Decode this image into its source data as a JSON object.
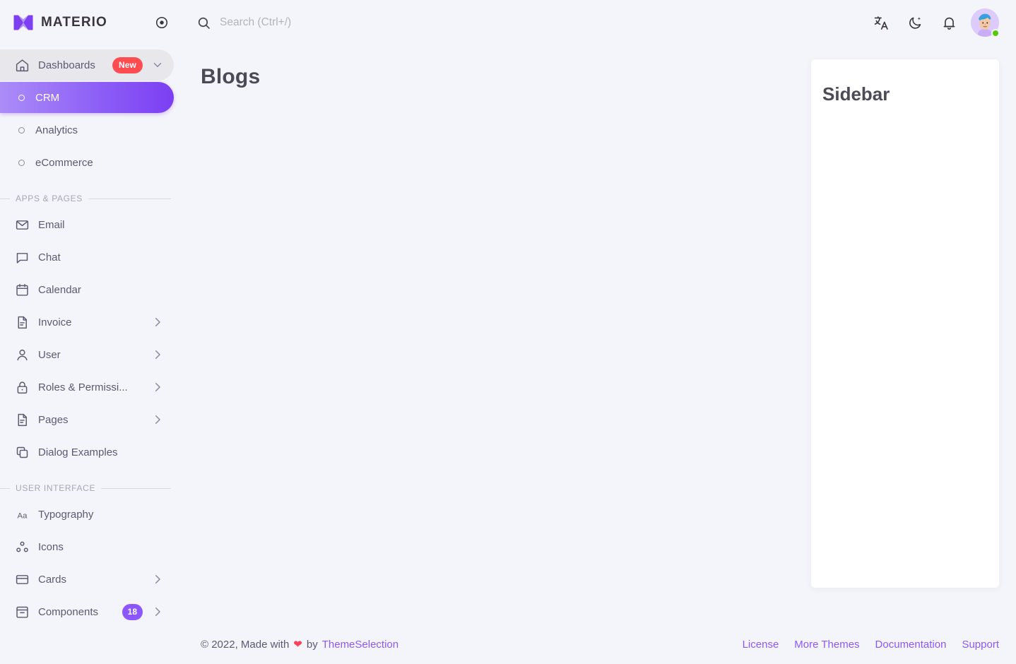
{
  "brand": {
    "name": "MATERIO",
    "logo_icon": "materio-m-logo",
    "pin_icon": "circle-dot-icon"
  },
  "colors": {
    "page_bg": "#F4F5FA",
    "accent": "#8C57FF",
    "active_gradient_from": "#AB8DF8",
    "active_gradient_to": "#7C3FF2",
    "badge_new": "#FF4C51",
    "online": "#56CA00",
    "heading": "#4D4A58",
    "nav_text": "#5E5873",
    "card_bg": "#FFFFFF"
  },
  "search": {
    "placeholder": "Search (Ctrl+/)",
    "value": "",
    "icon": "search-icon"
  },
  "topbar": {
    "actions": [
      {
        "name": "translate-icon",
        "label": "Language"
      },
      {
        "name": "moon-icon",
        "label": "Dark mode"
      },
      {
        "name": "bell-icon",
        "label": "Notifications"
      }
    ],
    "avatar": {
      "name": "avatar",
      "status": "online"
    }
  },
  "sidebar": {
    "groups": [
      {
        "section": null,
        "items": [
          {
            "label": "Dashboards",
            "icon": "home-icon",
            "badge": "New",
            "badge_type": "new",
            "chevron": "chevron-down-icon",
            "state": "hovered",
            "level": 0
          },
          {
            "label": "CRM",
            "icon": "circle-outline-icon",
            "state": "active",
            "level": 1
          },
          {
            "label": "Analytics",
            "icon": "circle-outline-icon",
            "state": "normal",
            "level": 1
          },
          {
            "label": "eCommerce",
            "icon": "circle-outline-icon",
            "state": "normal",
            "level": 1
          }
        ]
      },
      {
        "section": "APPS & PAGES",
        "items": [
          {
            "label": "Email",
            "icon": "mail-icon",
            "state": "normal",
            "level": 0
          },
          {
            "label": "Chat",
            "icon": "chat-icon",
            "state": "normal",
            "level": 0
          },
          {
            "label": "Calendar",
            "icon": "calendar-icon",
            "state": "normal",
            "level": 0
          },
          {
            "label": "Invoice",
            "icon": "file-text-icon",
            "chevron": "chevron-right-icon",
            "state": "normal",
            "level": 0
          },
          {
            "label": "User",
            "icon": "user-icon",
            "chevron": "chevron-right-icon",
            "state": "normal",
            "level": 0
          },
          {
            "label": "Roles & Permissi...",
            "icon": "lock-icon",
            "chevron": "chevron-right-icon",
            "state": "normal",
            "level": 0
          },
          {
            "label": "Pages",
            "icon": "file-text-icon",
            "chevron": "chevron-right-icon",
            "state": "normal",
            "level": 0
          },
          {
            "label": "Dialog Examples",
            "icon": "copy-icon",
            "state": "normal",
            "level": 0
          }
        ]
      },
      {
        "section": "USER INTERFACE",
        "items": [
          {
            "label": "Typography",
            "icon": "typography-aa-icon",
            "state": "normal",
            "level": 0
          },
          {
            "label": "Icons",
            "icon": "icons-dots-icon",
            "state": "normal",
            "level": 0
          },
          {
            "label": "Cards",
            "icon": "card-icon",
            "chevron": "chevron-right-icon",
            "state": "normal",
            "level": 0
          },
          {
            "label": "Components",
            "icon": "archive-icon",
            "badge": "18",
            "badge_type": "count",
            "chevron": "chevron-right-icon",
            "state": "normal",
            "level": 0
          }
        ]
      }
    ]
  },
  "main": {
    "page_title": "Blogs",
    "side_card_title": "Sidebar"
  },
  "footer": {
    "copyright_pre": "© 2022, Made with",
    "heart_icon": "heart-icon",
    "copyright_mid": "by",
    "author": "ThemeSelection",
    "links": [
      "License",
      "More Themes",
      "Documentation",
      "Support"
    ]
  }
}
